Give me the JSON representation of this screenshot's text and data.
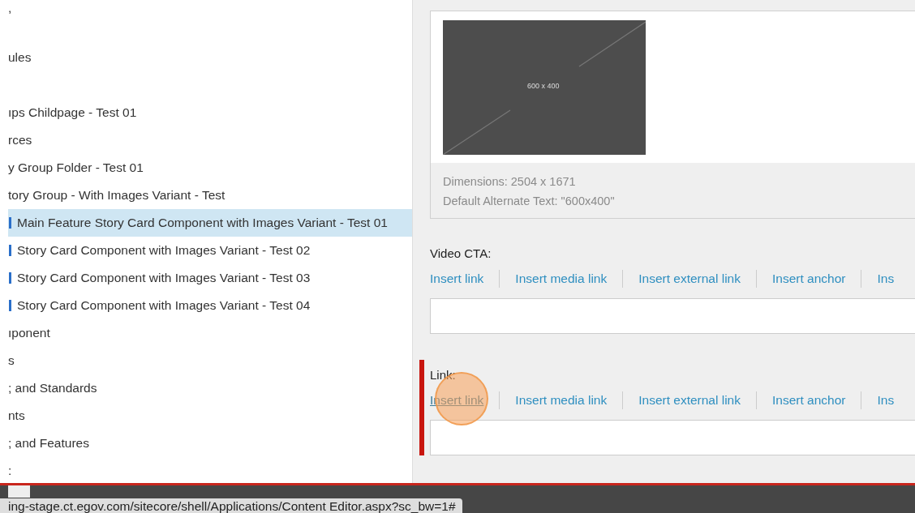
{
  "tree": {
    "items": [
      {
        "label": ",",
        "selected": false,
        "spaced": false,
        "icon": false
      },
      {
        "label": "ules",
        "selected": false,
        "spaced": true,
        "icon": false
      },
      {
        "label": "ıps Childpage - Test 01",
        "selected": false,
        "spaced": true,
        "icon": false
      },
      {
        "label": "rces",
        "selected": false,
        "spaced": false,
        "icon": false
      },
      {
        "label": "y Group Folder - Test 01",
        "selected": false,
        "spaced": false,
        "icon": false
      },
      {
        "label": "tory Group - With Images Variant - Test",
        "selected": false,
        "spaced": false,
        "icon": false
      },
      {
        "label": "Main Feature Story Card Component with Images Variant - Test 01",
        "selected": true,
        "spaced": false,
        "icon": true
      },
      {
        "label": "Story Card Component with Images Variant - Test 02",
        "selected": false,
        "spaced": false,
        "icon": true
      },
      {
        "label": "Story Card Component with Images Variant - Test 03",
        "selected": false,
        "spaced": false,
        "icon": true
      },
      {
        "label": "Story Card Component with Images Variant - Test 04",
        "selected": false,
        "spaced": false,
        "icon": true
      },
      {
        "label": "ıponent",
        "selected": false,
        "spaced": false,
        "icon": false
      },
      {
        "label": "s",
        "selected": false,
        "spaced": false,
        "icon": false
      },
      {
        "label": "; and Standards",
        "selected": false,
        "spaced": false,
        "icon": false
      },
      {
        "label": "nts",
        "selected": false,
        "spaced": false,
        "icon": false
      },
      {
        "label": "; and Features",
        "selected": false,
        "spaced": false,
        "icon": false
      },
      {
        "label": ":",
        "selected": false,
        "spaced": false,
        "icon": false
      }
    ]
  },
  "image_field": {
    "placeholder_label": "600 x 400",
    "dimensions": "Dimensions: 2504 x 1671",
    "alt_text": "Default Alternate Text: \"600x400\""
  },
  "fields": [
    {
      "label": "Video CTA:",
      "required": false,
      "clicked": false,
      "links": [
        "Insert link",
        "Insert media link",
        "Insert external link",
        "Insert anchor",
        "Ins"
      ]
    },
    {
      "label": "Link:",
      "required": true,
      "clicked": true,
      "links": [
        "Insert link",
        "Insert media link",
        "Insert external link",
        "Insert anchor",
        "Ins"
      ]
    }
  ],
  "status_bar": {
    "url": "ing-stage.ct.egov.com/sitecore/shell/Applications/Content Editor.aspx?sc_bw=1#"
  }
}
